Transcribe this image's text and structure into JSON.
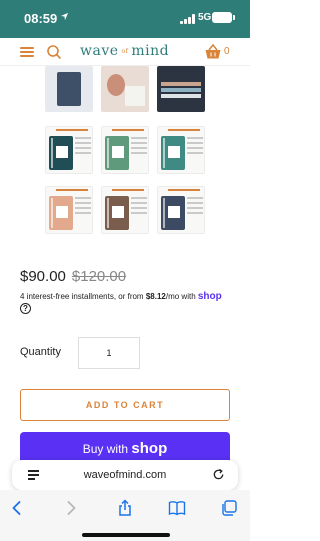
{
  "status_bar": {
    "time": "08:59",
    "network": "5G"
  },
  "header": {
    "logo_left": "wave",
    "logo_mid": "of",
    "logo_right": "mind",
    "cart_count": "0"
  },
  "gallery": {
    "photos": [
      {
        "name": "photo-planner-closed",
        "color": "#e6e9ee"
      },
      {
        "name": "photo-planner-hands",
        "color": "#e9dcd5"
      },
      {
        "name": "photo-planner-stack",
        "color": "#2c3442"
      }
    ],
    "thumbnails": [
      {
        "color": "#1f4e57"
      },
      {
        "color": "#5f9a7d"
      },
      {
        "color": "#3f8b84"
      },
      {
        "color": "#e3a98c"
      },
      {
        "color": "#7a5d4c"
      },
      {
        "color": "#3d4a64"
      }
    ]
  },
  "product": {
    "price": "$90.00",
    "old_price": "$120.00",
    "installments_text": "4 interest-free installments, or from ",
    "installments_amount": "$8.12",
    "installments_suffix": "/mo with ",
    "shop_pay": "shop",
    "help": "?"
  },
  "quantity": {
    "label": "Quantity",
    "value": "1"
  },
  "buttons": {
    "add_to_cart": "ADD TO CART",
    "buy_with": "Buy with ",
    "buy_shop": "shop"
  },
  "browser": {
    "url": "waveofmind.com"
  },
  "colors": {
    "brand_teal": "#2f7d79",
    "accent_orange": "#d9843a",
    "shop_purple": "#5a31f4"
  }
}
